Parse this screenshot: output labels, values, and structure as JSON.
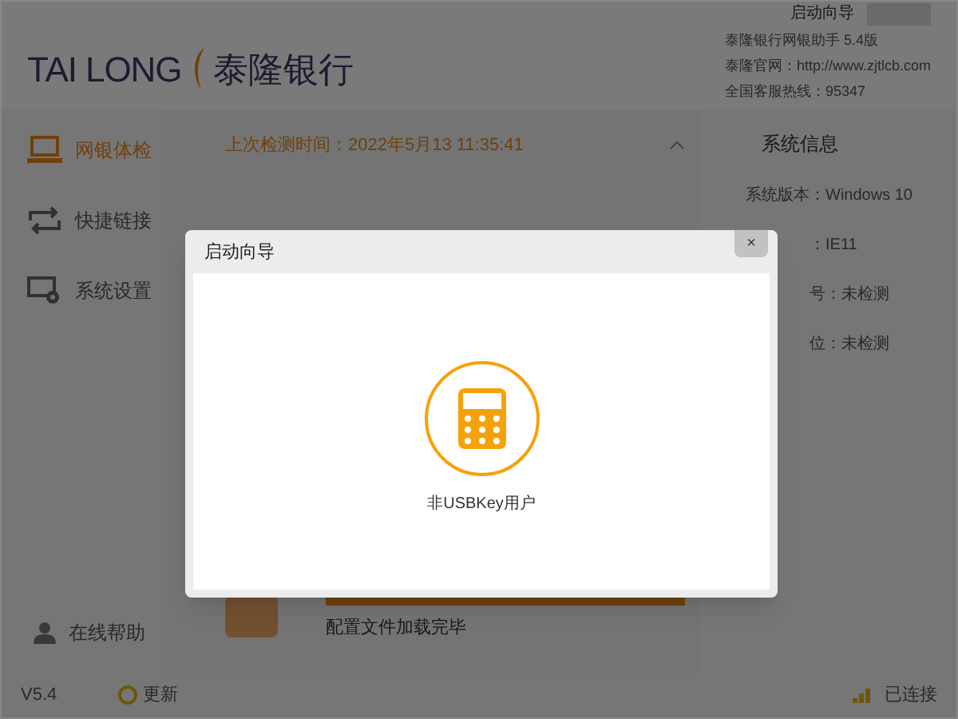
{
  "header": {
    "logo_latin": "TAI LONG",
    "logo_chinese": "泰隆银行",
    "guide_button": "启动向导",
    "info": [
      "泰隆银行网银助手 5.4版",
      "泰隆官网：http://www.zjtlcb.com",
      "全国客服热线：95347"
    ]
  },
  "sidebar": {
    "items": [
      {
        "label": "网银体检",
        "kind": "laptop",
        "selected": true
      },
      {
        "label": "快捷链接",
        "kind": "links",
        "selected": false
      },
      {
        "label": "系统设置",
        "kind": "settings",
        "selected": false
      }
    ],
    "help": "在线帮助"
  },
  "main": {
    "last_check": "上次检测时间：2022年5月13 11:35:41",
    "progress": {
      "level": 1,
      "message": "配置文件加载完毕"
    }
  },
  "system_info": {
    "title": "系统信息",
    "items": [
      "系统版本：Windows 10",
      "：IE11",
      "号：未检测",
      "位：未检测"
    ]
  },
  "status_bar": {
    "version": "V5.4",
    "update": "更新",
    "connection": "已连接"
  },
  "dialog": {
    "title": "启动向导",
    "close": "×",
    "option": "非USBKey用户"
  }
}
